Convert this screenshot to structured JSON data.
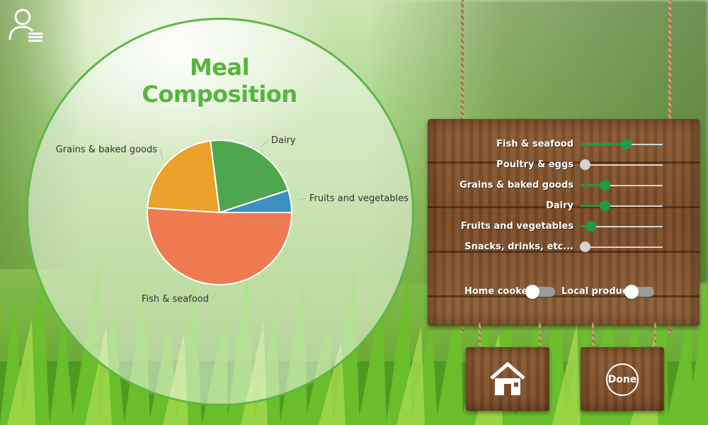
{
  "title": "Meal Composition",
  "chart_data": {
    "type": "pie",
    "title": "Meal Composition",
    "categories": [
      "Fruits and vegetables",
      "Dairy",
      "Grains & baked goods",
      "Fish & seafood"
    ],
    "values": [
      5,
      22,
      22,
      51
    ],
    "colors": [
      "#3d8fc4",
      "#4ea64e",
      "#eba12a",
      "#f07a50"
    ]
  },
  "sliders": [
    {
      "label": "Fish & seafood",
      "value": 0.48,
      "active": true
    },
    {
      "label": "Poultry & eggs",
      "value": 0.0,
      "active": false
    },
    {
      "label": "Grains & baked goods",
      "value": 0.22,
      "active": true
    },
    {
      "label": "Dairy",
      "value": 0.22,
      "active": true
    },
    {
      "label": "Fruits and vegetables",
      "value": 0.05,
      "active": true
    },
    {
      "label": "Snacks, drinks, etc...",
      "value": 0.0,
      "active": false
    }
  ],
  "toggles": [
    {
      "label": "Home cooked",
      "on": false
    },
    {
      "label": "Local produced",
      "on": false
    }
  ],
  "buttons": {
    "done": "Done"
  },
  "icons": {
    "user": "user-list-icon",
    "home": "home-icon"
  },
  "colors": {
    "accent_green": "#1f9a45",
    "title_green": "#55b63c",
    "inactive": "#d4d4d4"
  }
}
